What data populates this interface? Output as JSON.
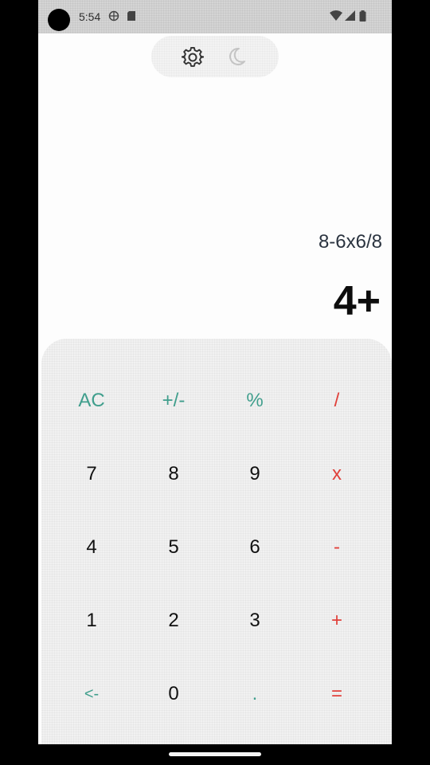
{
  "status_bar": {
    "time": "5:54",
    "left_icons": [
      "vpn-globe-icon",
      "sd-card-icon"
    ],
    "right_icons": [
      "wifi-icon",
      "cellular-signal-icon",
      "battery-icon"
    ]
  },
  "toolbar": {
    "icons": [
      "gear-icon",
      "moon-icon"
    ]
  },
  "display": {
    "expression": "8-6x6/8",
    "result": "4+"
  },
  "keypad": {
    "rows": [
      [
        {
          "label": "AC",
          "kind": "fn"
        },
        {
          "label": "+/-",
          "kind": "fn"
        },
        {
          "label": "%",
          "kind": "fn"
        },
        {
          "label": "/",
          "kind": "op"
        }
      ],
      [
        {
          "label": "7",
          "kind": "num"
        },
        {
          "label": "8",
          "kind": "num"
        },
        {
          "label": "9",
          "kind": "num"
        },
        {
          "label": "x",
          "kind": "op"
        }
      ],
      [
        {
          "label": "4",
          "kind": "num"
        },
        {
          "label": "5",
          "kind": "num"
        },
        {
          "label": "6",
          "kind": "num"
        },
        {
          "label": "-",
          "kind": "op"
        }
      ],
      [
        {
          "label": "1",
          "kind": "num"
        },
        {
          "label": "2",
          "kind": "num"
        },
        {
          "label": "3",
          "kind": "num"
        },
        {
          "label": "+",
          "kind": "op"
        }
      ],
      [
        {
          "label": "<-",
          "kind": "fn"
        },
        {
          "label": "0",
          "kind": "num"
        },
        {
          "label": ".",
          "kind": "fn"
        },
        {
          "label": "=",
          "kind": "op"
        }
      ]
    ]
  },
  "colors": {
    "function_key": "#3f9e8c",
    "operator_key": "#e0403a",
    "number_key": "#111111"
  }
}
